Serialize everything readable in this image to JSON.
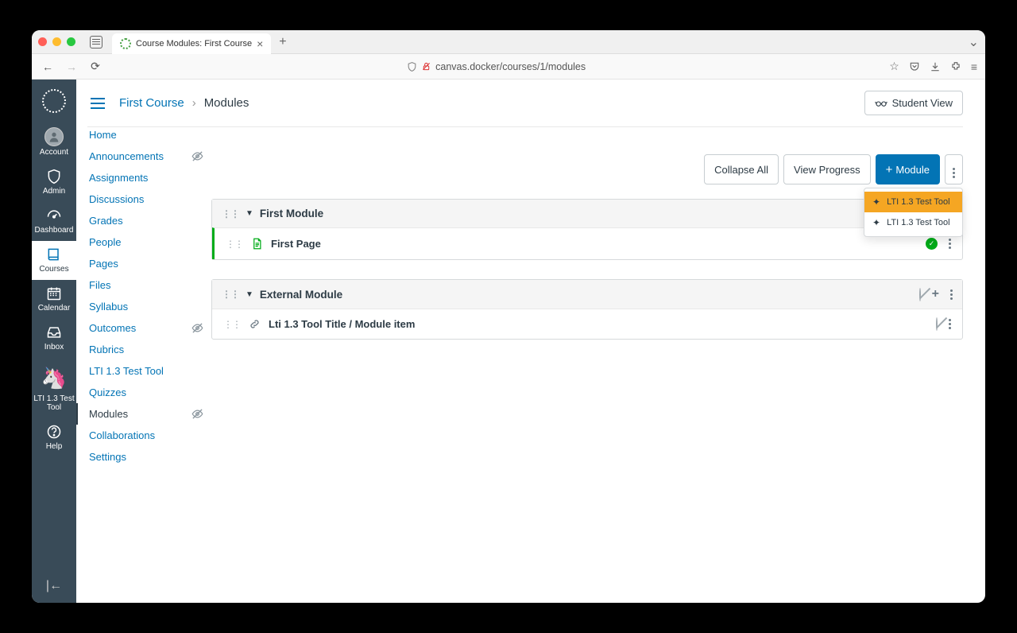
{
  "browser": {
    "tab_title": "Course Modules: First Course",
    "url": "canvas.docker/courses/1/modules"
  },
  "global_nav": {
    "items": [
      {
        "label": "Account"
      },
      {
        "label": "Admin"
      },
      {
        "label": "Dashboard"
      },
      {
        "label": "Courses"
      },
      {
        "label": "Calendar"
      },
      {
        "label": "Inbox"
      },
      {
        "label": "LTI 1.3 Test Tool"
      },
      {
        "label": "Help"
      }
    ]
  },
  "breadcrumb": {
    "course": "First Course",
    "page": "Modules"
  },
  "student_view_label": "Student View",
  "course_nav": [
    {
      "label": "Home"
    },
    {
      "label": "Announcements",
      "hidden": true
    },
    {
      "label": "Assignments"
    },
    {
      "label": "Discussions"
    },
    {
      "label": "Grades"
    },
    {
      "label": "People"
    },
    {
      "label": "Pages"
    },
    {
      "label": "Files"
    },
    {
      "label": "Syllabus"
    },
    {
      "label": "Outcomes",
      "hidden": true
    },
    {
      "label": "Rubrics"
    },
    {
      "label": "LTI 1.3 Test Tool"
    },
    {
      "label": "Quizzes"
    },
    {
      "label": "Modules",
      "active": true,
      "hidden": true
    },
    {
      "label": "Collaborations"
    },
    {
      "label": "Settings"
    }
  ],
  "toolbar": {
    "collapse": "Collapse All",
    "progress": "View Progress",
    "add_module": "Module"
  },
  "dropdown": {
    "items": [
      {
        "label": "LTI 1.3 Test Tool",
        "highlighted": true
      },
      {
        "label": "LTI 1.3 Test Tool"
      }
    ]
  },
  "modules": [
    {
      "name": "First Module",
      "show_header_actions": false,
      "items": [
        {
          "title": "First Page",
          "type": "page",
          "published": true
        }
      ]
    },
    {
      "name": "External Module",
      "show_header_actions": true,
      "items": [
        {
          "title": "Lti 1.3 Tool Title / Module item",
          "type": "link",
          "published": false
        }
      ]
    }
  ]
}
